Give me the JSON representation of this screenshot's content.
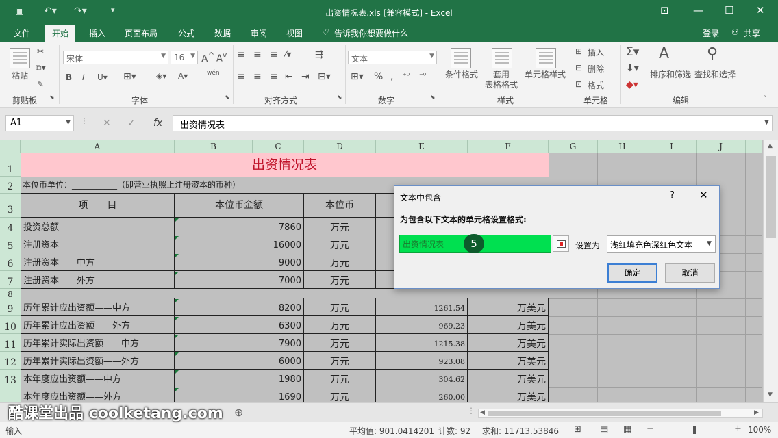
{
  "window": {
    "title": "出资情况表.xls  [兼容模式] - Excel",
    "accent": "#217346"
  },
  "menu": {
    "tabs": [
      "文件",
      "开始",
      "插入",
      "页面布局",
      "公式",
      "数据",
      "审阅",
      "视图"
    ],
    "active_tab": "开始",
    "tell_me": "告诉我你想要做什么",
    "login": "登录",
    "share": "共享"
  },
  "ribbon": {
    "groups": {
      "clipboard": "剪贴板",
      "font": "字体",
      "alignment": "对齐方式",
      "number": "数字",
      "styles": "样式",
      "cells": "单元格",
      "editing": "编辑"
    },
    "paste": "粘贴",
    "font_name": "宋体",
    "font_size": "16",
    "number_format": "文本",
    "wen": "wén",
    "conditional_format": "条件格式",
    "table_format_1": "套用",
    "table_format_2": "表格格式",
    "cell_styles": "单元格样式",
    "insert": "插入",
    "delete": "删除",
    "format": "格式",
    "sort_filter": "排序和筛选",
    "find_select": "查找和选择"
  },
  "formula_bar": {
    "name_box": "A1",
    "content": "出资情况表"
  },
  "sheet": {
    "columns": [
      "A",
      "B",
      "C",
      "D",
      "E",
      "F",
      "G",
      "H",
      "I",
      "J"
    ],
    "rows": [
      "1",
      "2",
      "3",
      "4",
      "5",
      "6",
      "7",
      "8",
      "9",
      "10",
      "11",
      "12",
      "13"
    ],
    "title": "出资情况表",
    "unit_line": "本位币单位：___________（即营业执照上注册资本的币种）",
    "header_item": "项　　目",
    "header_amount": "本位币金额",
    "header_unit": "本位币",
    "data_rows": [
      {
        "item": "投资总额",
        "amount": "7860",
        "unit": "万元"
      },
      {
        "item": "注册资本",
        "amount": "16000",
        "unit": "万元"
      },
      {
        "item": "注册资本——中方",
        "amount": "9000",
        "unit": "万元"
      },
      {
        "item": "注册资本——外方",
        "amount": "7000",
        "unit": "万元"
      }
    ],
    "data_rows2": [
      {
        "item": "历年累计应出资额——中方",
        "amount": "8200",
        "unit": "万元",
        "usd": "1261.54",
        "usd_unit": "万美元"
      },
      {
        "item": "历年累计应出资额——外方",
        "amount": "6300",
        "unit": "万元",
        "usd": "969.23",
        "usd_unit": "万美元"
      },
      {
        "item": "历年累计实际出资额——中方",
        "amount": "7900",
        "unit": "万元",
        "usd": "1215.38",
        "usd_unit": "万美元"
      },
      {
        "item": "历年累计实际出资额——外方",
        "amount": "6000",
        "unit": "万元",
        "usd": "923.08",
        "usd_unit": "万美元"
      },
      {
        "item": "本年度应出资额——中方",
        "amount": "1980",
        "unit": "万元",
        "usd": "304.62",
        "usd_unit": "万美元"
      },
      {
        "item": "本年度应出资额——外方",
        "amount": "1690",
        "unit": "万元",
        "usd": "260.00",
        "usd_unit": "万美元"
      }
    ]
  },
  "dialog": {
    "title": "文本中包含",
    "help": "?",
    "close": "✕",
    "prompt": "为包含以下文本的单元格设置格式:",
    "input_value": "出资情况表",
    "set_as_label": "设置为",
    "format_option": "浅红填充色深红色文本",
    "ok": "确定",
    "cancel": "取消"
  },
  "step_badge": "5",
  "status": {
    "mode": "输入",
    "average": "平均值: 901.0414201",
    "count": "计数: 92",
    "sum": "求和: 11713.53846",
    "zoom": "100%"
  },
  "watermark": "酷课堂出品 coolketang.com"
}
